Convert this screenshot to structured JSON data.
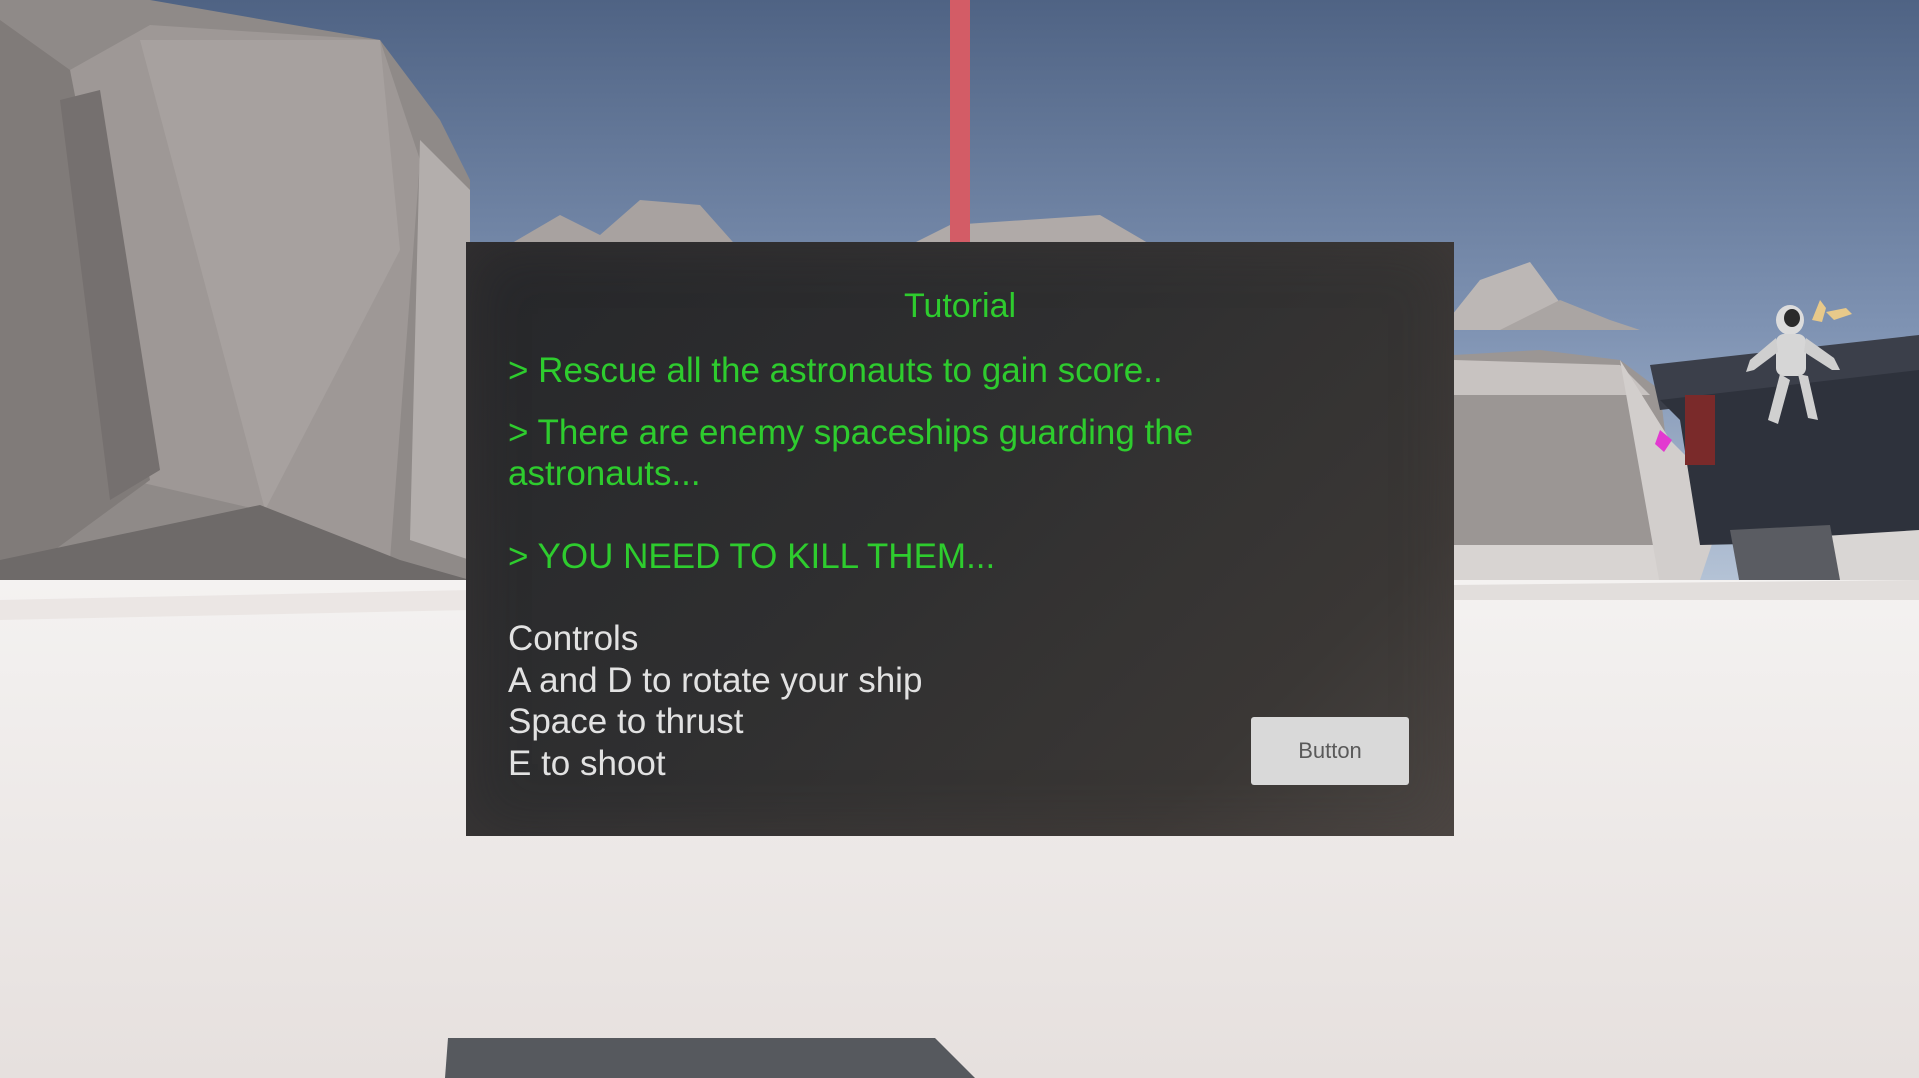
{
  "tutorial": {
    "title": "Tutorial",
    "lines": [
      "> Rescue all the astronauts to gain score..",
      "> There are enemy spaceships guarding the astronauts...",
      "> YOU NEED TO KILL THEM..."
    ],
    "controls": [
      "Controls",
      "A and D to rotate your ship",
      "Space to thrust",
      "E to shoot"
    ],
    "button_label": "Button"
  },
  "colors": {
    "objective_text": "#2ecc2e",
    "controls_text": "#e2e2e2",
    "panel_background": "#2f2f30",
    "button_background": "#d9d9d9",
    "button_text": "#5a5a5a",
    "sky_top": "#4f6384",
    "sky_horizon": "#a9bcd4",
    "ground": "#eeeae8",
    "beam": "#d35c66"
  }
}
